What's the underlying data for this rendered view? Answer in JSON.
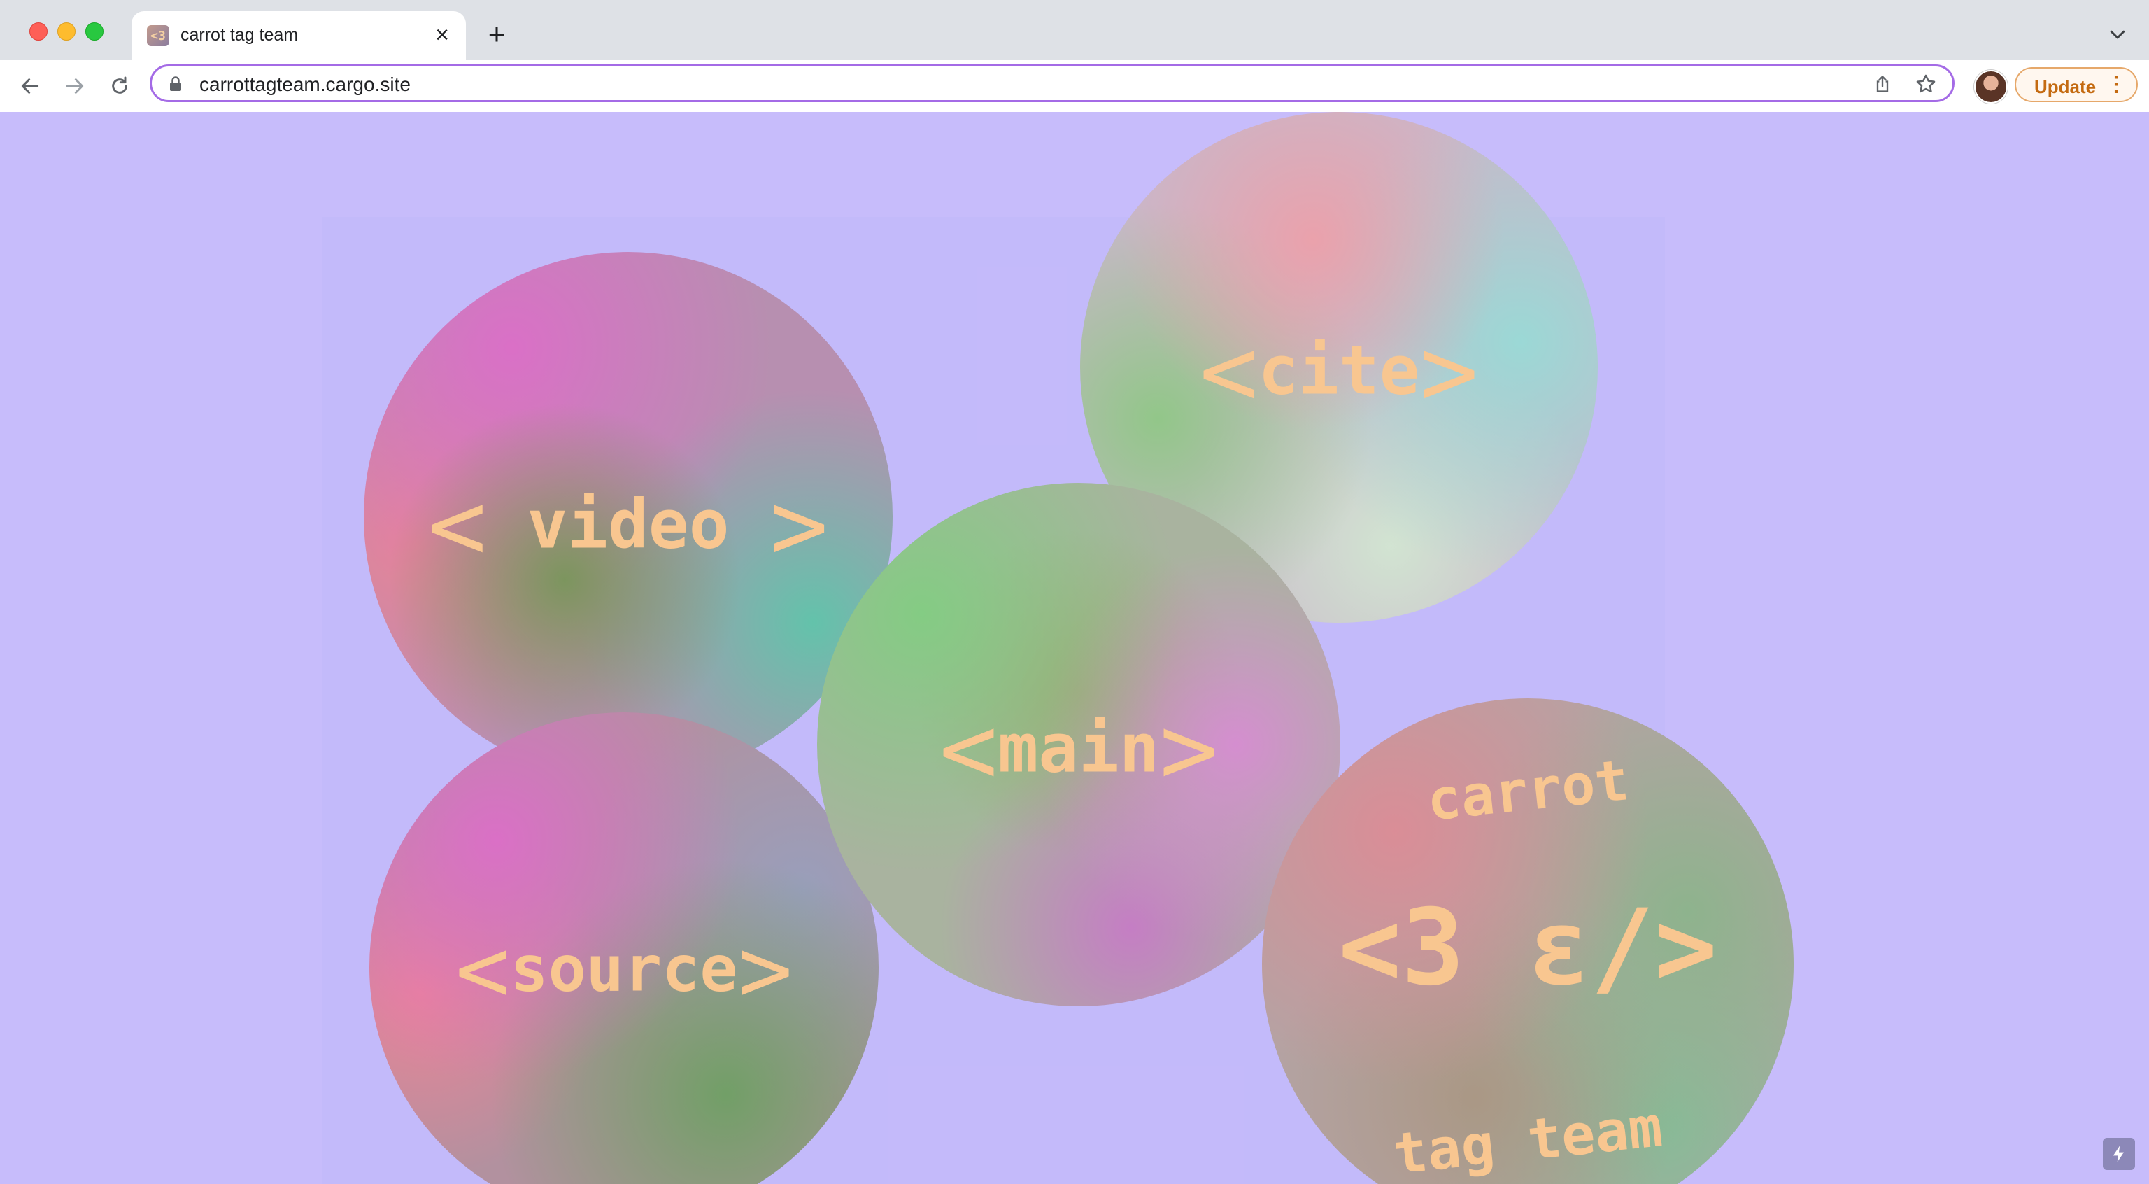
{
  "window": {
    "tab_title": "carrot tag team",
    "url": "carrottagteam.cargo.site",
    "update_label": "Update",
    "more_menu": "⋮"
  },
  "icons": {
    "tab_close": "×",
    "new_tab": "+",
    "lightning": "⚡"
  },
  "page": {
    "background_color": "#c7bcfb",
    "text_color": "#f8c690",
    "spheres": {
      "video": {
        "open": "<",
        "word": "video",
        "close": ">"
      },
      "cite": {
        "open": "<",
        "word": "cite",
        "close": ">"
      },
      "main": {
        "open": "<",
        "word": "main",
        "close": ">"
      },
      "source": {
        "open": "<",
        "word": "source",
        "close": ">"
      },
      "logo": {
        "top": "carrot",
        "middle": "<3 ε/>",
        "bottom": "tag team"
      }
    }
  }
}
